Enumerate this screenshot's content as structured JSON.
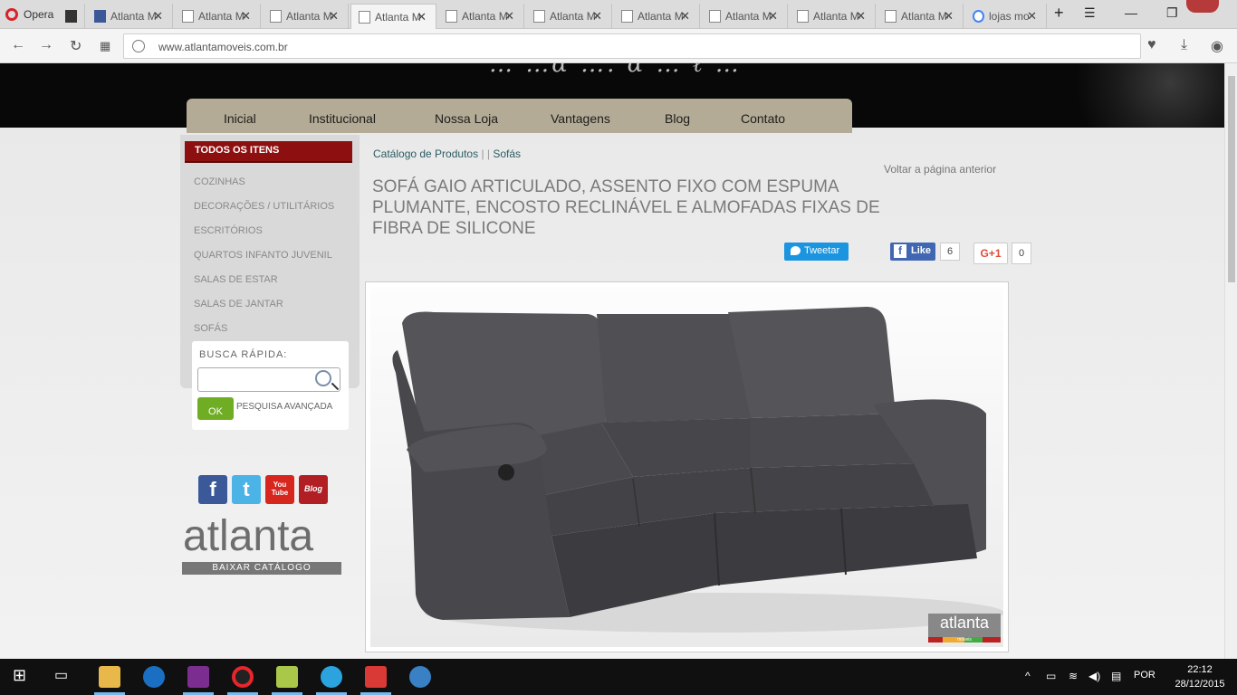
{
  "browser": {
    "menu_label": "Opera",
    "tabs": [
      {
        "title": "Atlanta Mo",
        "icon": "facebook-icon"
      },
      {
        "title": "Atlanta Mo",
        "icon": "page-icon"
      },
      {
        "title": "Atlanta Mo",
        "icon": "page-icon"
      },
      {
        "title": "Atlanta M",
        "icon": "page-icon"
      },
      {
        "title": "Atlanta Mo",
        "icon": "page-icon"
      },
      {
        "title": "Atlanta Mo",
        "icon": "page-icon"
      },
      {
        "title": "Atlanta Mo",
        "icon": "page-icon"
      },
      {
        "title": "Atlanta Mo",
        "icon": "page-icon"
      },
      {
        "title": "Atlanta Mo",
        "icon": "page-icon"
      },
      {
        "title": "Atlanta Mo",
        "icon": "page-icon"
      },
      {
        "title": "lojas mo",
        "icon": "google-icon"
      }
    ],
    "close_glyph": "✕",
    "new_tab_glyph": "+",
    "url": "www.atlantamoveis.com.br"
  },
  "site": {
    "header_script": "… …ɑ …. ɑ … ℓ …",
    "nav": [
      "Inicial",
      "Institucional",
      "Nossa Loja",
      "Vantagens",
      "Blog",
      "Contato"
    ],
    "sidebar": {
      "all_items": "TODOS OS ITENS",
      "categories": [
        "COZINHAS",
        "DECORAÇÕES / UTILITÁRIOS",
        "ESCRITÓRIOS",
        "QUARTOS INFANTO JUVENIL",
        "SALAS DE ESTAR",
        "SALAS DE JANTAR",
        "SOFÁS"
      ]
    },
    "search": {
      "label": "BUSCA RÁPIDA:",
      "value": "",
      "ok": "OK",
      "advanced": "PESQUISA AVANÇADA"
    },
    "social": [
      "f",
      "t",
      "You Tube",
      "Blog"
    ],
    "logo": {
      "word": "atlanta",
      "download": "BAIXAR CATÁLOGO"
    },
    "breadcrumb": {
      "catalog": "Catálogo de Produtos",
      "separator": "| |",
      "category": "Sofás"
    },
    "back_link": "Voltar a página anterior",
    "product_title": "SOFÁ GAIO ARTICULADO, ASSENTO FIXO COM ESPUMA PLUMANTE, ENCOSTO RECLINÁVEL E ALMOFADAS FIXAS DE FIBRA DE SILICONE",
    "share": {
      "tweet": "Tweetar",
      "like": "Like",
      "like_count": "6",
      "gplus": "G+1",
      "gplus_count": "0"
    },
    "watermark": {
      "word": "atlanta",
      "sub": "móveis"
    }
  },
  "taskbar": {
    "lang": "POR",
    "time": "22:12",
    "date": "28/12/2015"
  },
  "colors": {
    "nav_bar": "#b3ab95",
    "all_items": "#8e0f0f",
    "ok_button": "#6fae24",
    "sofa": "#4a4a4d"
  }
}
